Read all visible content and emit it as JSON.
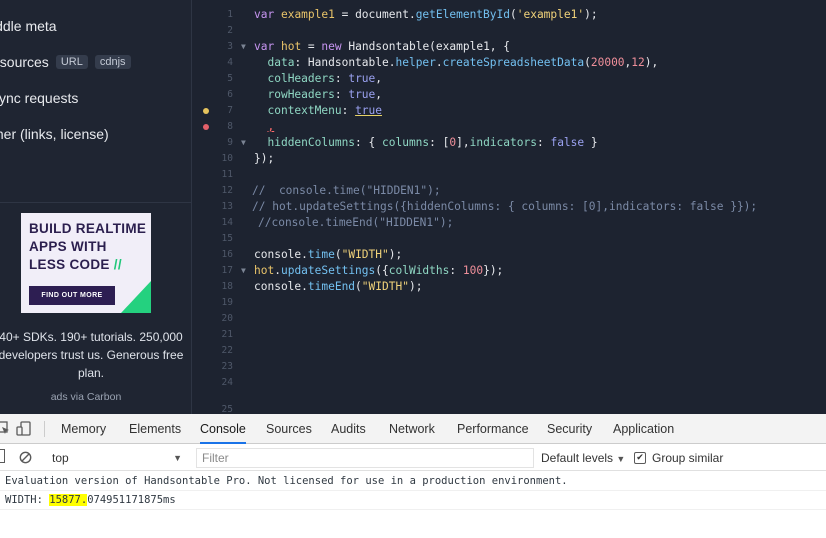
{
  "sidebar": {
    "items": [
      {
        "label": "iddle meta"
      },
      {
        "label": "esources",
        "badges": [
          "URL",
          "cdnjs"
        ]
      },
      {
        "label": "sync requests"
      },
      {
        "label": "ther (links, license)"
      }
    ]
  },
  "ad": {
    "headline_1": "BUILD REALTIME",
    "headline_2": "APPS WITH",
    "headline_3": "LESS CODE",
    "headline_slashes": "//",
    "cta": "FIND OUT MORE",
    "text": "40+ SDKs. 190+ tutorials. 250,000 developers trust us. Generous free plan.",
    "via": "ads via Carbon",
    "colors": {
      "bg": "#f1eef8",
      "dark": "#2d1e52",
      "accent": "#24d17f"
    }
  },
  "editor": {
    "line_numbers": [
      "1",
      "2",
      "3",
      "4",
      "5",
      "6",
      "7",
      "8",
      "9",
      "10",
      "11",
      "12",
      "13",
      "14",
      "15",
      "16",
      "17",
      "18",
      "19",
      "20",
      "21",
      "22",
      "23",
      "24",
      "25"
    ],
    "gutter_markers": {
      "warning_line": "7",
      "error_line": "8"
    }
  },
  "devtools": {
    "toolbar_icons": [
      "inspect-icon",
      "device-toggle-icon"
    ],
    "tabs": [
      "Memory",
      "Elements",
      "Console",
      "Sources",
      "Audits",
      "Network",
      "Performance",
      "Security",
      "Application"
    ],
    "active_tab": "Console",
    "context": "top",
    "filter_placeholder": "Filter",
    "levels": "Default levels",
    "group_similar": "Group similar",
    "group_similar_checked": true
  },
  "console": {
    "messages": [
      {
        "text": "Evaluation version of Handsontable Pro. Not licensed for use in a production environment."
      },
      {
        "label": "WIDTH: ",
        "highlighted": "15877.",
        "rest": "074951171875ms"
      }
    ],
    "highlight_color": "#ffff00"
  }
}
